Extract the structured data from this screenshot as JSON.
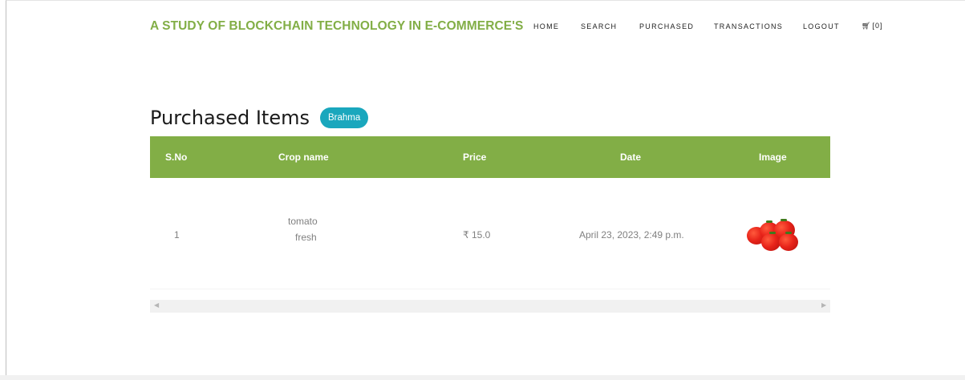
{
  "brand": "A STUDY OF BLOCKCHAIN TECHNOLOGY IN E-COMMERCE'S",
  "nav": {
    "home": "HOME",
    "search": "SEARCH",
    "purchased": "PURCHASED",
    "transactions": "TRANSACTIONS",
    "logout": "LOGOUT",
    "cart_count": "[0]"
  },
  "page": {
    "title": "Purchased Items",
    "user_badge": "Brahma"
  },
  "table": {
    "headers": [
      "S.No",
      "Crop name",
      "Price",
      "Date",
      "Image"
    ],
    "rows": [
      {
        "sno": "1",
        "crop_name_line1": "tomato",
        "crop_name_line2": "fresh",
        "price": "₹ 15.0",
        "date": "April 23, 2023, 2:49 p.m.",
        "image_icon": "tomato-image"
      }
    ]
  },
  "colors": {
    "accent_green": "#82ae46",
    "badge_teal": "#1aa7bd"
  }
}
